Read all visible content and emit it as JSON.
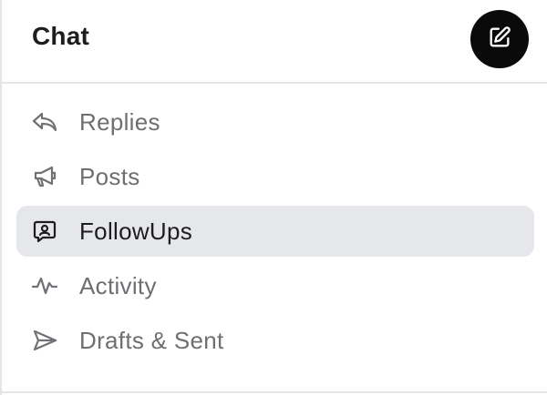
{
  "header": {
    "title": "Chat",
    "compose_icon": "edit-icon"
  },
  "nav": {
    "items": [
      {
        "label": "Replies",
        "icon": "reply-icon",
        "active": false
      },
      {
        "label": "Posts",
        "icon": "megaphone-icon",
        "active": false
      },
      {
        "label": "FollowUps",
        "icon": "followup-icon",
        "active": true
      },
      {
        "label": "Activity",
        "icon": "activity-icon",
        "active": false
      },
      {
        "label": "Drafts & Sent",
        "icon": "send-icon",
        "active": false
      }
    ]
  },
  "colors": {
    "active_background": "#e6e7ea",
    "inactive_text": "#6e6e73",
    "active_text": "#1d1d1f",
    "compose_button": "#0a0a0a"
  }
}
